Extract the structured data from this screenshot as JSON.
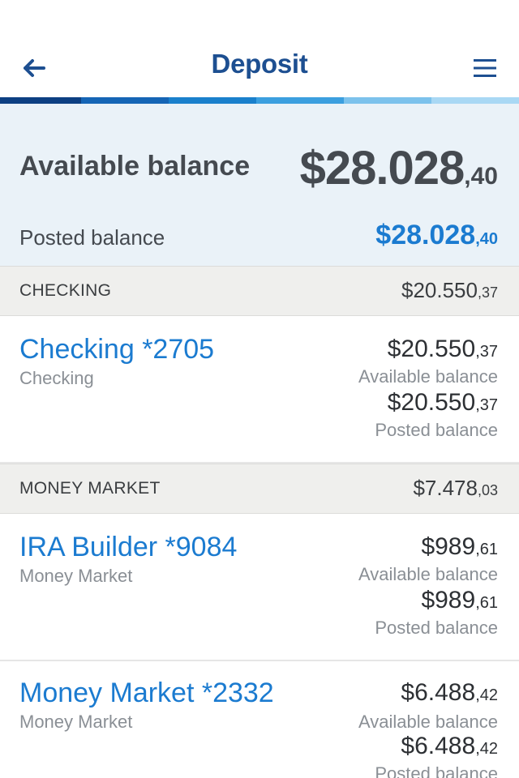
{
  "header": {
    "title": "Deposit",
    "back_icon": "arrow-left-icon",
    "menu_icon": "hamburger-menu-icon"
  },
  "progress_colors": [
    "#0d3f82",
    "#1565b5",
    "#1a80cc",
    "#3b9fdf",
    "#7cc2ec",
    "#a9d8f4"
  ],
  "summary": {
    "available_label": "Available balance",
    "available_whole": "$28.028",
    "available_cents": ",40",
    "posted_label": "Posted balance",
    "posted_whole": "$28.028",
    "posted_cents": ",40"
  },
  "sections": [
    {
      "title": "CHECKING",
      "total_whole": "$20.550",
      "total_cents": ",37",
      "accounts": [
        {
          "name": "Checking *2705",
          "type": "Checking",
          "available_whole": "$20.550",
          "available_cents": ",37",
          "available_label": "Available balance",
          "posted_whole": "$20.550",
          "posted_cents": ",37",
          "posted_label": "Posted balance"
        }
      ]
    },
    {
      "title": "MONEY MARKET",
      "total_whole": "$7.478",
      "total_cents": ",03",
      "accounts": [
        {
          "name": "IRA Builder *9084",
          "type": "Money Market",
          "available_whole": "$989",
          "available_cents": ",61",
          "available_label": "Available balance",
          "posted_whole": "$989",
          "posted_cents": ",61",
          "posted_label": "Posted balance"
        },
        {
          "name": "Money Market *2332",
          "type": "Money Market",
          "available_whole": "$6.488",
          "available_cents": ",42",
          "available_label": "Available balance",
          "posted_whole": "$6.488",
          "posted_cents": ",42",
          "posted_label": "Posted balance"
        }
      ]
    }
  ]
}
